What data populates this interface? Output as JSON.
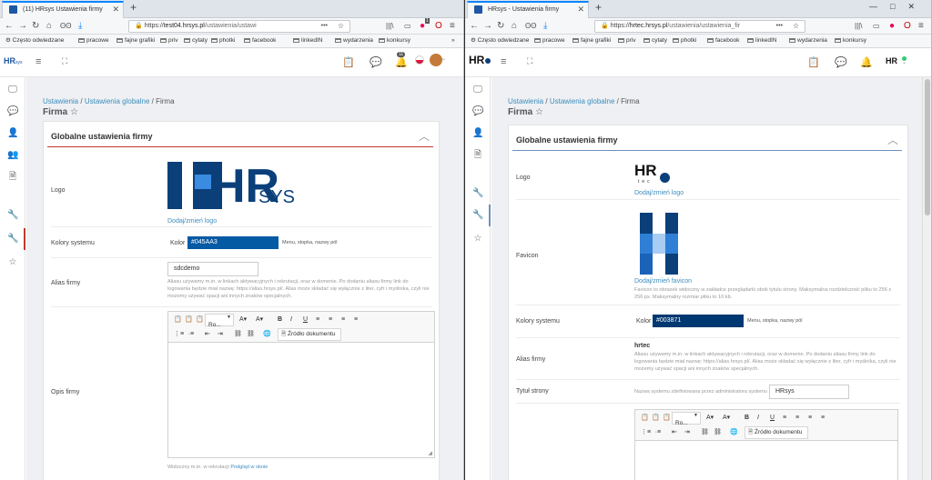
{
  "left": {
    "tab_title": "(11) HRsys Ustawienia firmy",
    "url_scheme": "https://",
    "url_host": "test04.hrsys.pl",
    "url_path": "/ustawienia/ustawi",
    "url_dots": "•••",
    "notif_count": "11",
    "url_badge": "1",
    "breadcrumb": {
      "a": "Ustawienia",
      "sep1": " / ",
      "b": "Ustawienia globalne",
      "sep2": " / ",
      "c": "Firma"
    },
    "page_title": "Firma",
    "section_title": "Globalne ustawienia firmy",
    "logo": {
      "label": "Logo",
      "link": "Dodaj/zmień logo",
      "brand_big": "HR",
      "brand_small": "SYS"
    },
    "colors": {
      "label": "Kolory systemu",
      "prefix": "Kolor",
      "value": "#045AA3",
      "hint": "Menu, stopka, nazwy pól"
    },
    "alias": {
      "label": "Alias firmy",
      "value": "sdcdemo",
      "help": "Aliasu używamy m.in. w linkach aktywacyjnych i rekrutacji, oraz w domenie. Po dodaniu aliasu firmy link do logowania będzie miał nazwę: https://alias.hrsys.pl/. Alias może składać się wyłącznie z liter, cyfr i myślnika, czyli nie możemy używać spacji ani innych znaków specjalnych."
    },
    "desc": {
      "label": "Opis firmy",
      "font": "Ro...",
      "source_btn": "Źródło dokumentu",
      "footer_text": "Widoczny m.in. w rekrutacji",
      "footer_link": "Podgląd w oknie"
    }
  },
  "right": {
    "tab_title": "HRsys - Ustawienia firmy",
    "url_scheme": "https://",
    "url_host": "hrtec.hrsys.pl",
    "url_path": "/ustawienia/ustawienia_fir",
    "url_dots": "•••",
    "breadcrumb": {
      "a": "Ustawienia",
      "sep1": " / ",
      "b": "Ustawienia globalne",
      "sep2": " / ",
      "c": "Firma"
    },
    "page_title": "Firma",
    "section_title": "Globalne ustawienia firmy",
    "logo": {
      "label": "Logo",
      "link": "Dodaj/zmień logo",
      "brand_big": "HR",
      "brand_small": "tec"
    },
    "favicon": {
      "label": "Favicon",
      "link": "Dodaj/zmień favicon",
      "help": "Favicon to obrazek widoczny w zakładce przeglądarki obok tytułu strony. Maksymalna rozdzielczość pliku to 256 x 256 px. Maksymalny rozmiar pliku to 10 kb."
    },
    "colors": {
      "label": "Kolory systemu",
      "prefix": "Kolor",
      "value": "#003871",
      "hint": "Menu, stopka, nazwy pól"
    },
    "alias": {
      "label": "Alias firmy",
      "value": "hrtec",
      "help": "Aliasu używamy m.in. w linkach aktywacyjnych i rekrutacji, oraz w domenie. Po dodaniu aliasu firmy link do logowania będzie miał nazwę: https://alias.hrsys.pl/. Alias może składać się wyłącznie z liter, cyfr i myślnika, czyli nie możemy używać spacji ani innych znaków specjalnych."
    },
    "title": {
      "label": "Tytuł strony",
      "help": "Nazwa systemu zdefiniowana przez administratora systemu",
      "value": "HRsys"
    },
    "desc": {
      "font": "Ro...",
      "source_btn": "Źródło dokumentu"
    }
  },
  "bookmarks": [
    "Często odwiedzane",
    "pracowe",
    "fajne grafiki",
    "priv",
    "cytaty",
    "photki",
    "facebook",
    "linkedIN",
    "wydarzenia",
    "konkursy"
  ],
  "colors_ui": {
    "left_accent": "#045AA3",
    "right_accent": "#003871",
    "link": "#3c8dbc",
    "left_rule": "#c0392b",
    "right_rule": "#6f8fbf"
  }
}
